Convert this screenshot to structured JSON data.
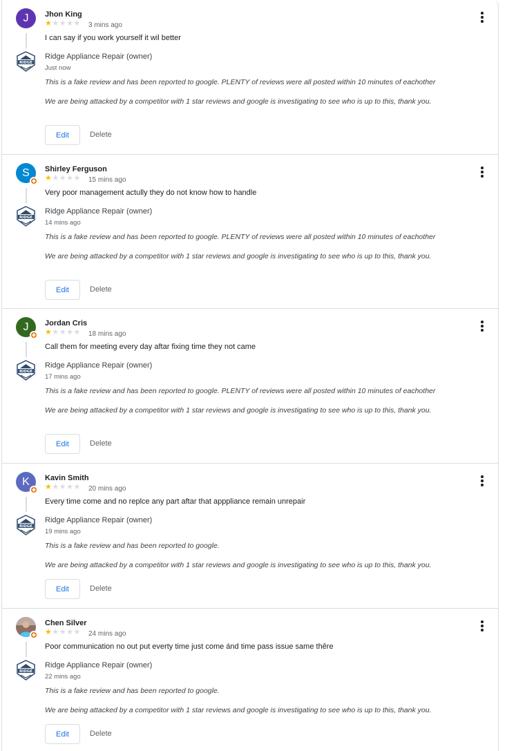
{
  "owner_name": "Ridge Appliance Repair (owner)",
  "logo_text": "RIDGE",
  "edit_label": "Edit",
  "delete_label": "Delete",
  "reviews": [
    {
      "initial": "J",
      "avatar_color": "#5e35b1",
      "name": "Jhon King",
      "rating": 1,
      "time": "3 mins ago",
      "text": "I can say if you work yourself it wil better",
      "owner_time": "Just now",
      "reply_1": "This is a fake review and has been reported to google. PLENTY of reviews were all posted within 10 minutes of eachother",
      "reply_2": "We are being attacked by a competitor with 1 star reviews and google is investigating to see who is up to this, thank you."
    },
    {
      "initial": "S",
      "avatar_color": "#0288d1",
      "name": "Shirley Ferguson",
      "rating": 1,
      "time": "15 mins ago",
      "text": "Very poor management actully they do not know how to handle",
      "owner_time": "14 mins ago",
      "reply_1": "This is a fake review and has been reported to google. PLENTY of reviews were all posted within 10 minutes of eachother",
      "reply_2": "We are being attacked by a competitor with 1 star reviews and google is investigating to see who is up to this, thank you."
    },
    {
      "initial": "J",
      "avatar_color": "#33691e",
      "name": "Jordan Cris",
      "rating": 1,
      "time": "18 mins ago",
      "text": "Call them for meeting every day aftar fixing time they not came",
      "owner_time": "17 mins ago",
      "reply_1": "This is a fake review and has been reported to google. PLENTY of reviews were all posted within 10 minutes of eachother",
      "reply_2": "We are being attacked by a competitor with 1 star reviews and google is investigating to see who is up to this, thank you."
    },
    {
      "initial": "K",
      "avatar_color": "#5c6bc0",
      "name": "Kavin Smith",
      "rating": 1,
      "time": "20 mins ago",
      "text": "Every time come and no replce any part aftar that apppliance remain unrepair",
      "owner_time": "19 mins ago",
      "reply_1": "This is a fake review and has been reported to google.",
      "reply_2": "We are being attacked by a competitor with 1 star reviews and google is investigating to see who is up to this, thank you."
    },
    {
      "initial": "",
      "avatar_color": "#a1887f",
      "name": "Chen Silver",
      "rating": 1,
      "time": "24 mins ago",
      "text": "Poor communication no out put everty time just come ánd time pass issue same thêre",
      "owner_time": "22 mins ago",
      "reply_1": "This is a fake review and has been reported to google.",
      "reply_2": "We are being attacked by a competitor with 1 star reviews and google is investigating to see who is up to this, thank you."
    }
  ]
}
